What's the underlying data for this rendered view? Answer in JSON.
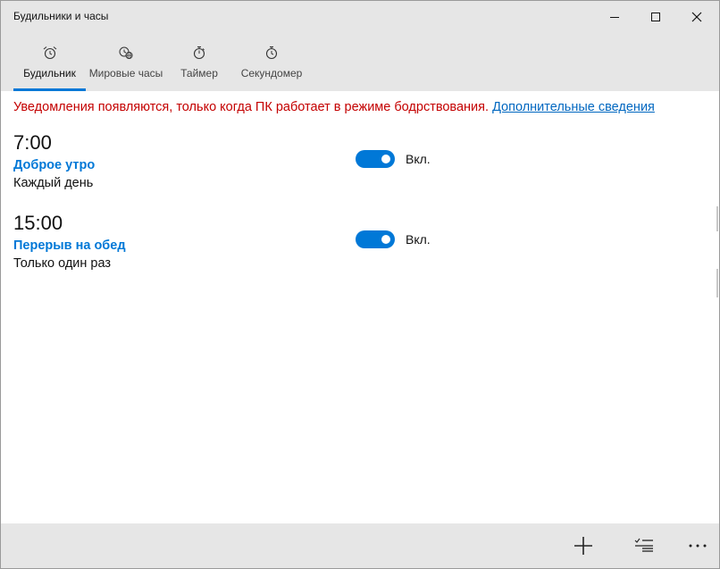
{
  "window": {
    "title": "Будильники и часы"
  },
  "tabs": [
    {
      "label": "Будильник",
      "icon": "alarm-clock-icon",
      "active": true
    },
    {
      "label": "Мировые часы",
      "icon": "world-clock-icon",
      "active": false
    },
    {
      "label": "Таймер",
      "icon": "timer-icon",
      "active": false
    },
    {
      "label": "Секундомер",
      "icon": "stopwatch-icon",
      "active": false
    }
  ],
  "notice": {
    "text": "Уведомления появляются, только когда ПК работает в режиме бодрствования.",
    "link": "Дополнительные сведения"
  },
  "alarms": [
    {
      "time": "7:00",
      "name": "Доброе утро",
      "repeat": "Каждый день",
      "state_label": "Вкл.",
      "enabled": true
    },
    {
      "time": "15:00",
      "name": "Перерыв на обед",
      "repeat": "Только один раз",
      "state_label": "Вкл.",
      "enabled": true
    }
  ],
  "bottom_bar": {
    "icons": [
      "plus-icon",
      "select-list-icon",
      "more-icon"
    ]
  },
  "colors": {
    "accent": "#0078d7",
    "warning": "#c40000",
    "link": "#0067c0",
    "chrome": "#e6e6e6"
  }
}
